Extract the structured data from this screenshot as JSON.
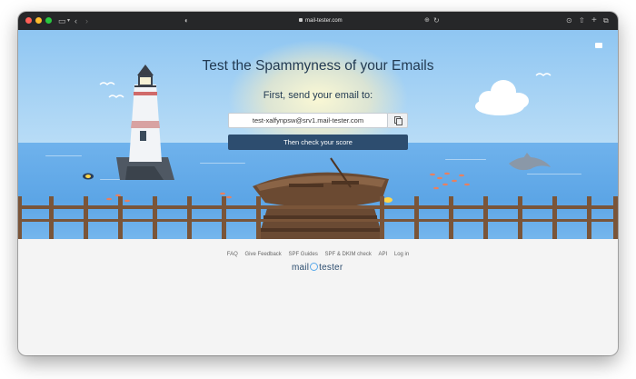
{
  "browser": {
    "url": "mail-tester.com"
  },
  "hero": {
    "title": "Test the Spammyness of your Emails",
    "instruction": "First, send your email to:",
    "email_address": "test-xalfynpsw@srv1.mail-tester.com",
    "cta_label": "Then check your score"
  },
  "footer": {
    "links": [
      "FAQ",
      "Give Feedback",
      "SPF Guides",
      "SPF & DKIM check",
      "API",
      "Log in"
    ],
    "logo_left": "mail",
    "logo_right": "tester"
  },
  "colors": {
    "primary_button": "#2d4d6f",
    "sky": "#8fc6f2",
    "sea": "#5ca5e6",
    "page_background": "#f4f4f4"
  }
}
